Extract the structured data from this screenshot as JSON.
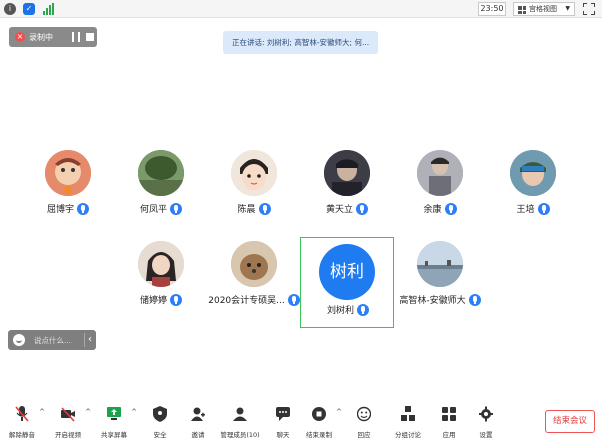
{
  "topbar": {
    "time": "23:50",
    "view_label": "宫格视图",
    "icons": [
      "info-icon",
      "shield-icon",
      "signal-icon",
      "grid-icon",
      "fullscreen-icon"
    ]
  },
  "recording": {
    "label": "录制中"
  },
  "speaking_banner": {
    "text": "正在讲话: 刘树利; 高智林-安徽师大; 何..."
  },
  "participants": [
    {
      "name": "屈博宇",
      "avatar_color": "#d96a4f"
    },
    {
      "name": "何凤平",
      "avatar_color": "#4d6b3a"
    },
    {
      "name": "陈晨",
      "avatar_color": "#e8d8c8"
    },
    {
      "name": "黄天立",
      "avatar_color": "#3d3d48"
    },
    {
      "name": "余康",
      "avatar_color": "#9a9aa2"
    },
    {
      "name": "王培",
      "avatar_color": "#6f9ab0"
    },
    {
      "name": "储婷婷",
      "avatar_color": "#c9b8a8"
    },
    {
      "name": "2020会计专硕吴...",
      "avatar_color": "#b99c7e"
    },
    {
      "name": "刘树利",
      "avatar_text": "树利",
      "avatar_color": "#1e7cf0",
      "selected": true
    },
    {
      "name": "高智林-安徽师大",
      "avatar_color": "#9fb6c9"
    }
  ],
  "chat": {
    "placeholder": "说点什么..."
  },
  "toolbar": {
    "items": [
      {
        "label": "解除静音"
      },
      {
        "label": "开启视频"
      },
      {
        "label": "共享屏幕"
      },
      {
        "label": "安全"
      },
      {
        "label": "邀请"
      },
      {
        "label": "管理成员(10)"
      },
      {
        "label": "聊天"
      },
      {
        "label": "结束录制"
      },
      {
        "label": "回应"
      },
      {
        "label": "分组讨论"
      },
      {
        "label": "应用"
      },
      {
        "label": "设置"
      }
    ],
    "end_label": "结束会议"
  },
  "colors": {
    "accent": "#2d7ff9",
    "selected_border": "#3cc35a",
    "end_red": "#e23b3b",
    "banner_bg": "#dbe9fb"
  }
}
